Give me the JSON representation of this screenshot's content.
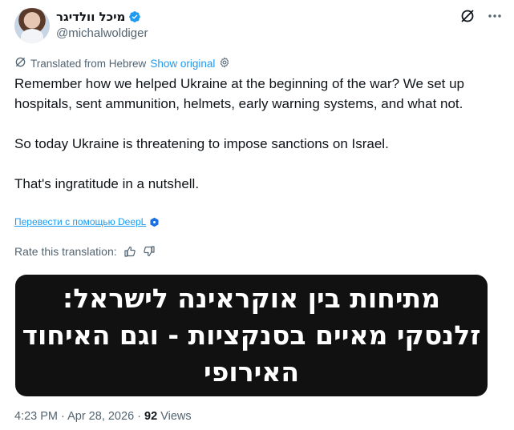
{
  "author": {
    "display_name": "מיכל וולדיגר",
    "handle": "@michalwoldiger"
  },
  "translation": {
    "label": "Translated from Hebrew",
    "show_original": "Show original"
  },
  "tweet": {
    "paragraphs": [
      "Remember how we helped Ukraine at the beginning of the war? We set up hospitals, sent ammunition, helmets, early warning systems, and what not.",
      "So today Ukraine is threatening to impose sanctions on Israel.",
      "That's ingratitude in a nutshell."
    ]
  },
  "deepl": {
    "link_text": "Перевести с помощью DeepL"
  },
  "rate": {
    "label": "Rate this translation:"
  },
  "media": {
    "text": "מתיחות בין אוקראינה לישראל: זלנסקי מאיים בסנקציות - וגם האיחוד האירופי"
  },
  "meta": {
    "time": "4:23 PM",
    "separator": " · ",
    "date": "Apr 28, 2026",
    "views_count": "92",
    "views_label": " Views"
  },
  "colors": {
    "accent": "#1d9bf0",
    "text": "#0f1419",
    "muted": "#536471"
  }
}
